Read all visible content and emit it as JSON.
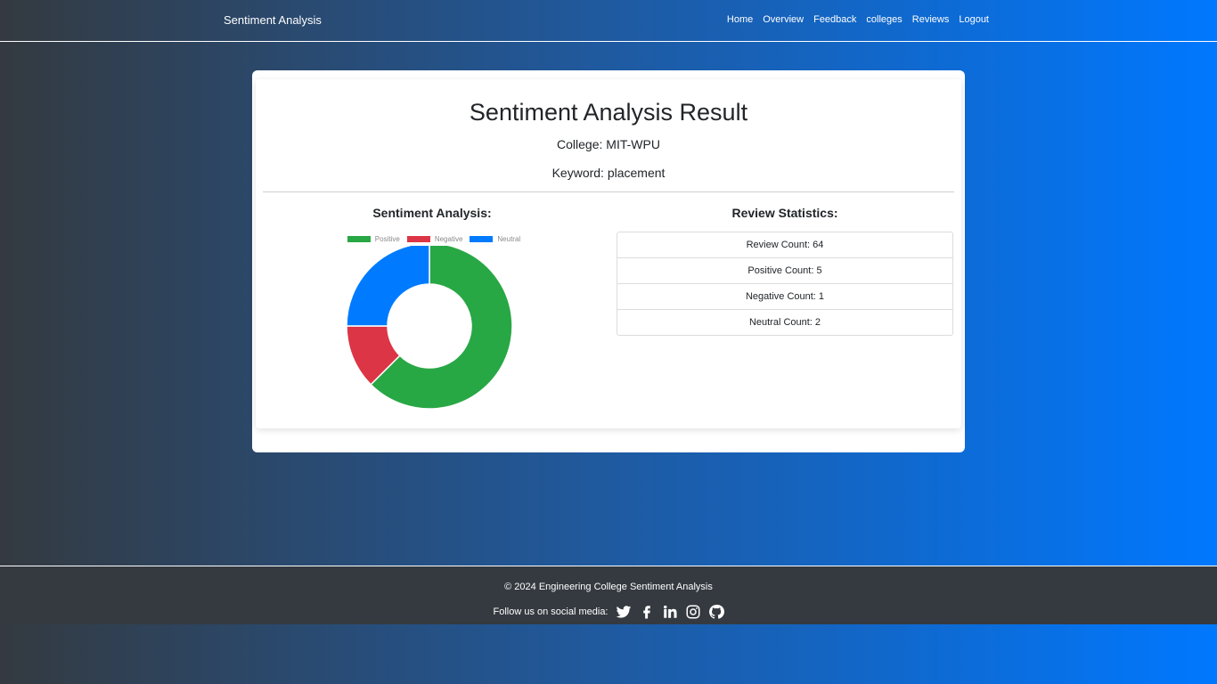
{
  "nav": {
    "brand": "Sentiment Analysis",
    "links": [
      "Home",
      "Overview",
      "Feedback",
      "colleges",
      "Reviews",
      "Logout"
    ]
  },
  "result": {
    "title": "Sentiment Analysis Result",
    "college": "College: MIT-WPU",
    "keyword": "Keyword: placement",
    "left_heading": "Sentiment Analysis:",
    "right_heading": "Review Statistics:"
  },
  "stats": {
    "review_count": "Review Count: 64",
    "positive_count": "Positive Count: 5",
    "negative_count": "Negative Count: 1",
    "neutral_count": "Neutral Count: 2"
  },
  "chart_data": {
    "type": "pie",
    "categories": [
      "Positive",
      "Negative",
      "Neutral"
    ],
    "values": [
      5,
      1,
      2
    ],
    "colors": [
      "#28a745",
      "#dc3545",
      "#007bff"
    ],
    "donut": true,
    "legend": "top"
  },
  "footer": {
    "copyright": "© 2024 Engineering College Sentiment Analysis",
    "follow": "Follow us on social media:",
    "icons": [
      "twitter-icon",
      "facebook-icon",
      "linkedin-icon",
      "instagram-icon",
      "github-icon"
    ]
  }
}
